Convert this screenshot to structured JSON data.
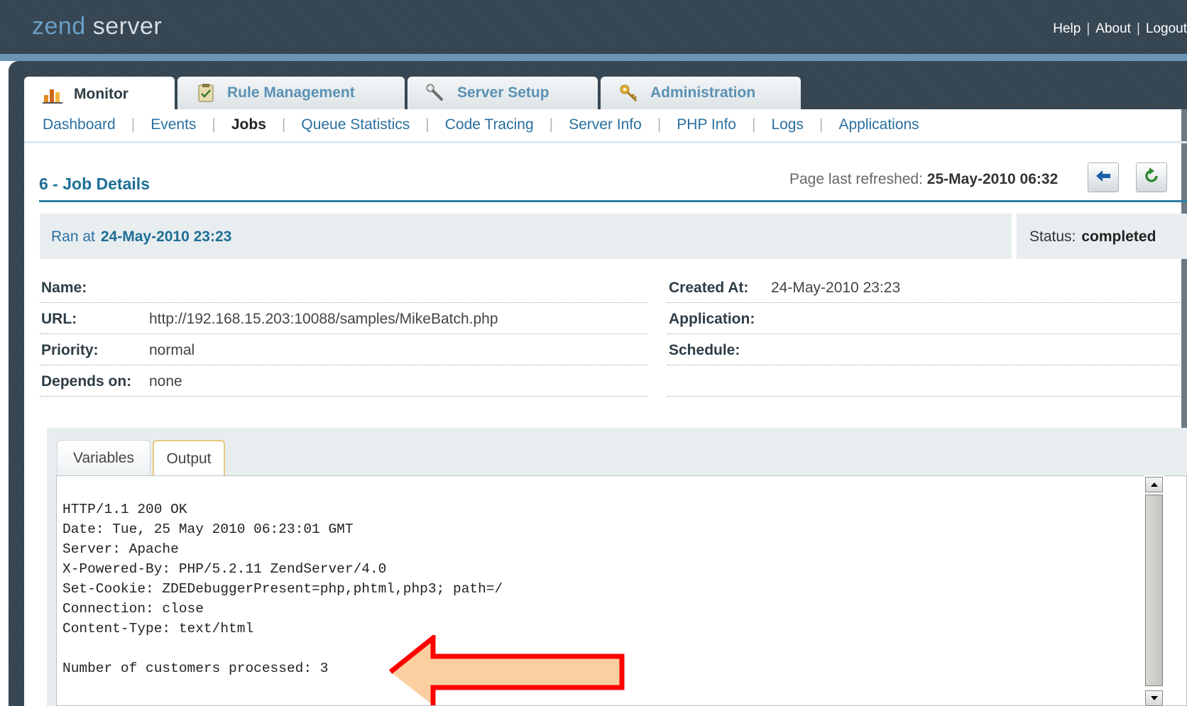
{
  "header": {
    "logo_primary": "zend",
    "logo_secondary": "server",
    "links": [
      "Help",
      "About",
      "Logout"
    ],
    "link_separator": "|"
  },
  "tabs": [
    {
      "label": "Monitor",
      "icon": "bar-chart-icon",
      "active": true
    },
    {
      "label": "Rule Management",
      "icon": "clipboard-icon",
      "active": false
    },
    {
      "label": "Server Setup",
      "icon": "wrench-icon",
      "active": false
    },
    {
      "label": "Administration",
      "icon": "key-icon",
      "active": false
    }
  ],
  "subnav": {
    "items": [
      "Dashboard",
      "Events",
      "Jobs",
      "Queue Statistics",
      "Code Tracing",
      "Server Info",
      "PHP Info",
      "Logs",
      "Applications"
    ],
    "active": "Jobs",
    "separator": "|"
  },
  "page": {
    "title": "6 - Job Details",
    "refreshed_label": "Page last refreshed:",
    "refreshed_value": "25-May-2010 06:32"
  },
  "ran": {
    "label": "Ran at",
    "value": "24-May-2010 23:23",
    "status_label": "Status:",
    "status_value": "completed"
  },
  "details_left": [
    {
      "label": "Name:",
      "value": ""
    },
    {
      "label": "URL:",
      "value": "http://192.168.15.203:10088/samples/MikeBatch.php"
    },
    {
      "label": "Priority:",
      "value": "normal"
    },
    {
      "label": "Depends on:",
      "value": "none"
    }
  ],
  "details_right": [
    {
      "label": "Created At:",
      "value": "24-May-2010 23:23"
    },
    {
      "label": "Application:",
      "value": ""
    },
    {
      "label": "Schedule:",
      "value": ""
    },
    {
      "label": "",
      "value": ""
    }
  ],
  "output_tabs": [
    {
      "label": "Variables",
      "active": false
    },
    {
      "label": "Output",
      "active": true
    }
  ],
  "output_lines": [
    "HTTP/1.1 200 OK",
    "Date: Tue, 25 May 2010 06:23:01 GMT",
    "Server: Apache",
    "X-Powered-By: PHP/5.2.11 ZendServer/4.0",
    "Set-Cookie: ZDEDebuggerPresent=php,phtml,php3; path=/",
    "Connection: close",
    "Content-Type: text/html",
    "",
    "Number of customers processed: 3"
  ],
  "colors": {
    "accent": "#1e6f96",
    "link": "#2a6fa0",
    "header_bg": "#344451",
    "arrow_stroke": "#ff0000",
    "arrow_fill": "#fbcf9f"
  }
}
